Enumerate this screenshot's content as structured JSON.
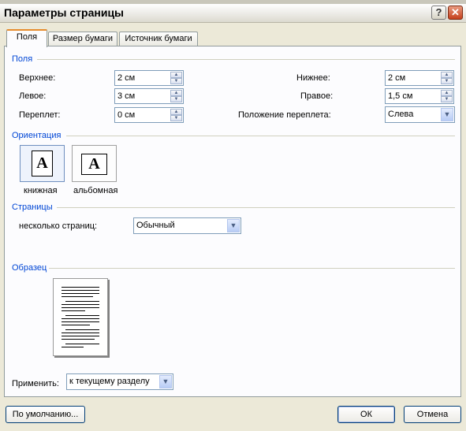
{
  "window": {
    "title": "Параметры страницы",
    "help_glyph": "?",
    "close_glyph": "✕"
  },
  "tabs": [
    {
      "label": "Поля",
      "active": true
    },
    {
      "label": "Размер бумаги",
      "active": false
    },
    {
      "label": "Источник бумаги",
      "active": false
    }
  ],
  "margins": {
    "group_label": "Поля",
    "top": {
      "label": "Верхнее:",
      "value": "2 см"
    },
    "left": {
      "label": "Левое:",
      "value": "3 см"
    },
    "gutter": {
      "label": "Переплет:",
      "value": "0 см"
    },
    "bottom": {
      "label": "Нижнее:",
      "value": "2 см"
    },
    "right": {
      "label": "Правое:",
      "value": "1,5 см"
    },
    "gutter_pos": {
      "label": "Положение переплета:",
      "value": "Слева"
    }
  },
  "orientation": {
    "group_label": "Ориентация",
    "portrait_label": "книжная",
    "landscape_label": "альбомная",
    "page_glyph": "A",
    "selected": "portrait"
  },
  "pages": {
    "group_label": "Страницы",
    "multiple_label": "несколько страниц:",
    "multiple_value": "Обычный"
  },
  "sample": {
    "group_label": "Образец"
  },
  "apply": {
    "label": "Применить:",
    "value": "к текущему разделу"
  },
  "buttons": {
    "default": "По умолчанию...",
    "ok": "ОК",
    "cancel": "Отмена"
  },
  "icons": {
    "spin_up": "▲",
    "spin_down": "▼",
    "dropdown": "▼"
  }
}
